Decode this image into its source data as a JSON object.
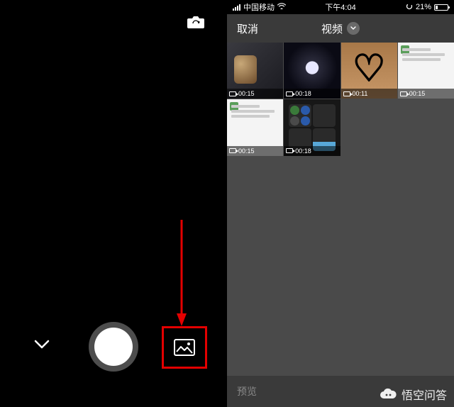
{
  "left": {
    "icons": {
      "camera_flip": "camera-flip-icon",
      "chevron": "chevron-down-icon",
      "gallery": "gallery-icon"
    }
  },
  "right": {
    "status": {
      "carrier": "中国移动",
      "time": "下午4:04",
      "battery_pct": "21%"
    },
    "nav": {
      "cancel": "取消",
      "title": "视频"
    },
    "thumbs": [
      {
        "duration": "00:15"
      },
      {
        "duration": "00:18"
      },
      {
        "duration": "00:11"
      },
      {
        "duration": "00:15"
      },
      {
        "duration": "00:15"
      },
      {
        "duration": "00:18"
      }
    ],
    "bottom": {
      "preview": "预览"
    }
  },
  "watermark": {
    "text": "悟空问答"
  }
}
